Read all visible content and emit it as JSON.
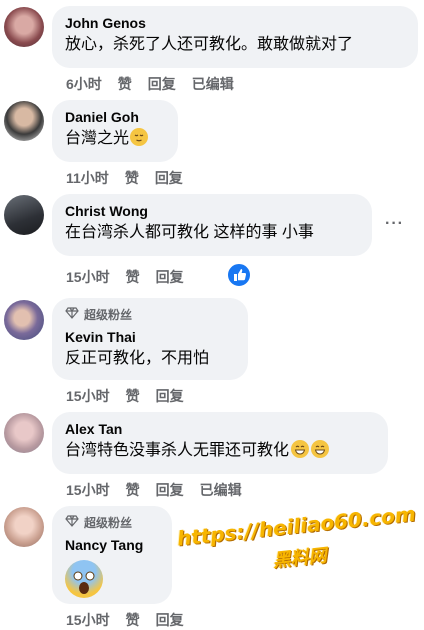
{
  "comments": [
    {
      "name": "John Genos",
      "text": "放心，杀死了人还可教化。敢敢做就对了",
      "time": "6小时",
      "like": "赞",
      "reply": "回复",
      "edited": "已编辑"
    },
    {
      "name": "Daniel Goh",
      "text": "台灣之光",
      "time": "11小时",
      "like": "赞",
      "reply": "回复"
    },
    {
      "name": "Christ Wong",
      "text": "在台湾杀人都可教化 这样的事 小事",
      "time": "15小时",
      "like": "赞",
      "reply": "回复",
      "more": "···"
    },
    {
      "badge": "超级粉丝",
      "name": "Kevin Thai",
      "text": "反正可教化，不用怕",
      "time": "15小时",
      "like": "赞",
      "reply": "回复"
    },
    {
      "name": "Alex Tan",
      "text": "台湾特色没事杀人无罪还可教化",
      "time": "15小时",
      "like": "赞",
      "reply": "回复",
      "edited": "已编辑"
    },
    {
      "badge": "超级粉丝",
      "name": "Nancy Tang",
      "time": "15小时",
      "like": "赞",
      "reply": "回复"
    }
  ],
  "watermark": {
    "line1": "https://heiliao60.com",
    "line2": "黑料网"
  }
}
